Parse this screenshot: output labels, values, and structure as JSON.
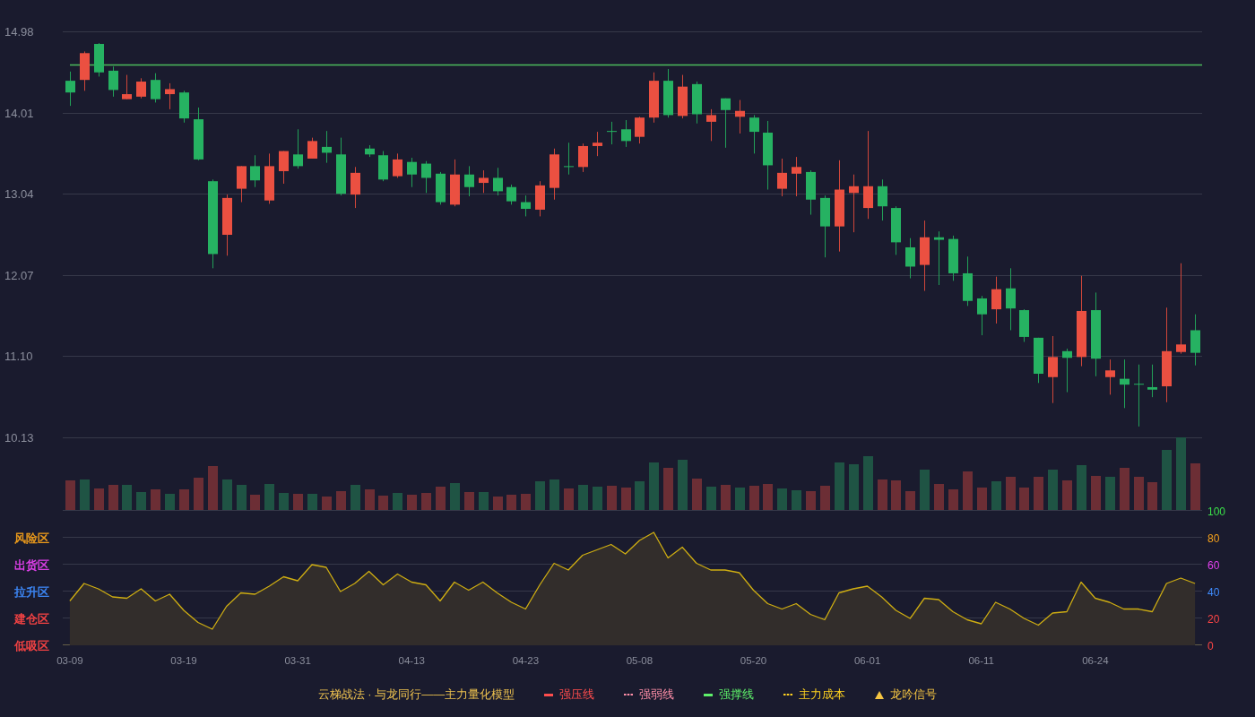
{
  "price_chart": {
    "chart_data": {
      "type": "candlestick",
      "grid": true,
      "ylim": [
        10.13,
        14.98
      ],
      "yticks": [
        {
          "value": 14.98,
          "label": "14.98"
        },
        {
          "value": 14.01,
          "label": "14.01"
        },
        {
          "value": 13.04,
          "label": "13.04"
        },
        {
          "value": 12.07,
          "label": "12.07"
        },
        {
          "value": 11.1,
          "label": "11.10"
        },
        {
          "value": 10.13,
          "label": "10.13"
        }
      ],
      "categories": [
        null,
        null,
        null,
        null,
        null,
        null,
        null,
        null,
        null,
        null,
        null,
        null,
        null,
        null,
        null,
        null,
        null,
        null,
        null,
        null,
        null,
        null,
        null,
        null,
        null,
        null,
        null,
        null,
        null,
        null,
        null,
        null,
        null,
        null,
        null,
        null,
        null,
        null,
        null,
        null,
        null,
        null,
        null,
        null,
        null,
        null,
        null,
        null,
        null,
        null,
        null,
        null,
        null,
        null,
        null,
        null,
        null,
        null,
        null,
        null,
        null,
        null,
        null,
        null,
        null,
        null,
        null,
        null,
        null,
        null,
        null,
        null,
        null,
        null,
        null,
        null,
        null,
        null,
        null,
        null
      ],
      "ohlc": [
        [
          14.39,
          14.5,
          14.09,
          14.25
        ],
        [
          14.4,
          14.74,
          14.27,
          14.72
        ],
        [
          14.83,
          14.84,
          14.44,
          14.49
        ],
        [
          14.51,
          14.56,
          14.2,
          14.28
        ],
        [
          14.17,
          14.46,
          14.17,
          14.23
        ],
        [
          14.2,
          14.42,
          14.18,
          14.38
        ],
        [
          14.4,
          14.48,
          14.13,
          14.17
        ],
        [
          14.23,
          14.36,
          14.05,
          14.29
        ],
        [
          14.25,
          14.27,
          13.89,
          13.94
        ],
        [
          13.93,
          14.07,
          13.44,
          13.45
        ],
        [
          13.19,
          13.21,
          12.15,
          12.32
        ],
        [
          12.55,
          13.03,
          12.3,
          12.99
        ],
        [
          13.1,
          13.37,
          12.94,
          13.37
        ],
        [
          13.37,
          13.5,
          13.12,
          13.2
        ],
        [
          12.96,
          13.52,
          12.92,
          13.37
        ],
        [
          13.31,
          13.55,
          13.16,
          13.55
        ],
        [
          13.51,
          13.81,
          13.34,
          13.37
        ],
        [
          13.46,
          13.71,
          13.46,
          13.67
        ],
        [
          13.6,
          13.79,
          13.41,
          13.53
        ],
        [
          13.51,
          13.71,
          13.02,
          13.04
        ],
        [
          13.03,
          13.36,
          12.87,
          13.29
        ],
        [
          13.58,
          13.62,
          13.48,
          13.51
        ],
        [
          13.5,
          13.55,
          13.19,
          13.21
        ],
        [
          13.25,
          13.52,
          13.23,
          13.45
        ],
        [
          13.42,
          13.47,
          13.12,
          13.27
        ],
        [
          13.4,
          13.43,
          13.05,
          13.23
        ],
        [
          13.28,
          13.3,
          12.91,
          12.94
        ],
        [
          12.91,
          13.45,
          12.89,
          13.27
        ],
        [
          13.27,
          13.37,
          13.01,
          13.12
        ],
        [
          13.17,
          13.32,
          13.05,
          13.23
        ],
        [
          13.23,
          13.35,
          13.02,
          13.07
        ],
        [
          13.12,
          13.15,
          12.91,
          12.95
        ],
        [
          12.94,
          13.02,
          12.77,
          12.86
        ],
        [
          12.85,
          13.19,
          12.77,
          13.14
        ],
        [
          13.11,
          13.58,
          12.97,
          13.51
        ],
        [
          13.37,
          13.65,
          13.27,
          13.37
        ],
        [
          13.36,
          13.64,
          13.3,
          13.61
        ],
        [
          13.61,
          13.78,
          13.49,
          13.65
        ],
        [
          13.79,
          13.9,
          13.63,
          13.79
        ],
        [
          13.81,
          13.92,
          13.6,
          13.67
        ],
        [
          13.72,
          13.96,
          13.64,
          13.95
        ],
        [
          13.95,
          14.49,
          13.89,
          14.39
        ],
        [
          14.39,
          14.53,
          13.95,
          13.98
        ],
        [
          13.97,
          14.46,
          13.94,
          14.32
        ],
        [
          14.35,
          14.38,
          13.88,
          13.99
        ],
        [
          13.9,
          14.05,
          13.67,
          13.98
        ],
        [
          14.18,
          14.18,
          13.59,
          14.04
        ],
        [
          13.96,
          14.16,
          13.76,
          14.03
        ],
        [
          13.95,
          13.98,
          13.52,
          13.78
        ],
        [
          13.77,
          13.91,
          13.09,
          13.38
        ],
        [
          13.1,
          13.46,
          13.01,
          13.29
        ],
        [
          13.28,
          13.48,
          13.01,
          13.36
        ],
        [
          13.3,
          13.32,
          12.79,
          12.97
        ],
        [
          12.99,
          13.02,
          12.28,
          12.65
        ],
        [
          12.65,
          13.44,
          12.35,
          13.09
        ],
        [
          13.05,
          13.27,
          12.58,
          13.13
        ],
        [
          12.87,
          13.79,
          12.74,
          13.13
        ],
        [
          13.13,
          13.21,
          12.72,
          12.89
        ],
        [
          12.87,
          12.89,
          12.31,
          12.46
        ],
        [
          12.4,
          12.51,
          12.03,
          12.17
        ],
        [
          12.19,
          12.72,
          11.88,
          12.52
        ],
        [
          12.52,
          12.59,
          11.95,
          12.49
        ],
        [
          12.5,
          12.54,
          12.0,
          12.09
        ],
        [
          12.09,
          12.29,
          11.7,
          11.76
        ],
        [
          11.79,
          11.82,
          11.35,
          11.6
        ],
        [
          11.66,
          12.05,
          11.49,
          11.9
        ],
        [
          11.91,
          12.15,
          11.41,
          11.67
        ],
        [
          11.65,
          11.66,
          11.27,
          11.33
        ],
        [
          11.32,
          11.32,
          10.78,
          10.89
        ],
        [
          10.85,
          11.34,
          10.54,
          11.09
        ],
        [
          11.16,
          11.19,
          10.67,
          11.08
        ],
        [
          11.09,
          12.06,
          10.98,
          11.64
        ],
        [
          11.65,
          11.86,
          10.86,
          11.07
        ],
        [
          10.85,
          11.06,
          10.64,
          10.93
        ],
        [
          10.83,
          11.06,
          10.48,
          10.76
        ],
        [
          10.77,
          11.0,
          10.26,
          10.77
        ],
        [
          10.73,
          11.0,
          10.61,
          10.7
        ],
        [
          10.74,
          11.68,
          10.55,
          11.16
        ],
        [
          11.15,
          12.21,
          11.13,
          11.24
        ],
        [
          11.41,
          11.6,
          10.99,
          11.14
        ]
      ],
      "ref_lines": [
        {
          "axis": "y",
          "value": 14.58,
          "color": "#4cbb5c"
        }
      ]
    }
  },
  "indicator_chart": {
    "axis_rows": [
      {
        "color": "#3be04a"
      },
      {
        "label": "风险区",
        "color": "#f7a21b"
      },
      {
        "label": "出货区",
        "color": "#e541f0"
      },
      {
        "label": "拉升区",
        "color": "#3f8cff"
      },
      {
        "label": "建仓区",
        "color": "#ff4545"
      },
      {
        "label": "低吸区",
        "color": "#ff4545"
      }
    ],
    "chart_data": {
      "type": "area",
      "grid": true,
      "ylim": [
        0,
        100
      ],
      "yticks": [
        {
          "value": 100,
          "label": "100"
        },
        {
          "value": 80,
          "label": "80"
        },
        {
          "value": 60,
          "label": "60"
        },
        {
          "value": 40,
          "label": "40"
        },
        {
          "value": 20,
          "label": "20"
        },
        {
          "value": 0,
          "label": "0"
        }
      ],
      "categories": [
        "03-09",
        null,
        null,
        null,
        null,
        null,
        null,
        null,
        "03-19",
        null,
        null,
        null,
        null,
        null,
        null,
        null,
        "03-31",
        null,
        null,
        null,
        null,
        null,
        null,
        null,
        "04-13",
        null,
        null,
        null,
        null,
        null,
        null,
        null,
        "04-23",
        null,
        null,
        null,
        null,
        null,
        null,
        null,
        "05-08",
        null,
        null,
        null,
        null,
        null,
        null,
        null,
        "05-20",
        null,
        null,
        null,
        null,
        null,
        null,
        null,
        "06-01",
        null,
        null,
        null,
        null,
        null,
        null,
        null,
        "06-11",
        null,
        null,
        null,
        null,
        null,
        null,
        null,
        "06-24",
        null,
        null,
        null,
        null,
        null,
        null,
        null
      ],
      "series": [
        {
          "color": "#cfae12",
          "values": [
            33,
            46,
            42,
            36,
            35,
            42,
            33,
            38,
            26,
            17,
            12,
            29,
            39,
            38,
            44,
            51,
            48,
            60,
            58,
            40,
            46,
            55,
            45,
            53,
            47,
            45,
            33,
            47,
            41,
            47,
            39,
            32,
            27,
            45,
            61,
            56,
            67,
            71,
            75,
            68,
            78,
            84,
            65,
            73,
            61,
            56,
            56,
            54,
            41,
            31,
            27,
            31,
            23,
            19,
            39,
            42,
            44,
            36,
            26,
            20,
            35,
            34,
            25,
            19,
            16,
            32,
            27,
            20,
            15,
            24,
            25,
            47,
            35,
            32,
            27,
            27,
            25,
            46,
            50,
            46
          ]
        }
      ]
    }
  },
  "legend": {
    "title": "云梯战法 · 与龙同行——主力量化模型",
    "items": [
      {
        "label": "强压线",
        "kind": "solid",
        "color": "#ff4d4d"
      },
      {
        "label": "强弱线",
        "kind": "dashed",
        "color": "#ff8fa8"
      },
      {
        "label": "强撑线",
        "kind": "solid",
        "color": "#5ef06a"
      },
      {
        "label": "主力成本",
        "kind": "dashed",
        "color": "#ffd21f"
      },
      {
        "label": "龙吟信号",
        "kind": "triangle",
        "color": "#f5c542"
      }
    ]
  }
}
